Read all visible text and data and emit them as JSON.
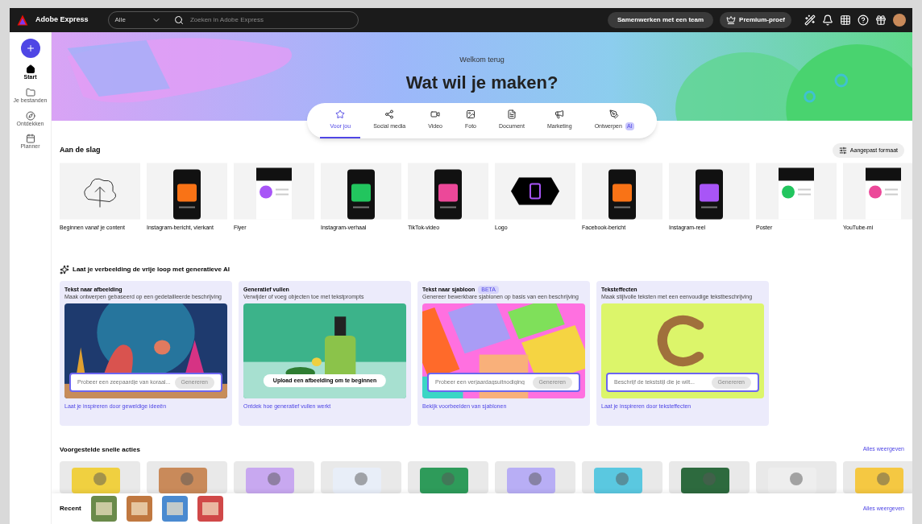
{
  "topbar": {
    "brand": "Adobe Express",
    "scope": "Alle",
    "search_placeholder": "Zoeken in Adobe Express",
    "buttons": [
      "Samenwerken met een team",
      "Premium-proef"
    ]
  },
  "sidebar": {
    "items": [
      {
        "label": "Start",
        "selected": true
      },
      {
        "label": "Je bestanden",
        "selected": false
      },
      {
        "label": "Ontdekken",
        "selected": false
      },
      {
        "label": "Planner",
        "selected": false
      }
    ]
  },
  "hero": {
    "greeting": "Welkom terug",
    "title": "Wat wil je maken?"
  },
  "tabs": [
    {
      "label": "Voor jou",
      "selected": true
    },
    {
      "label": "Social media",
      "selected": false
    },
    {
      "label": "Video",
      "selected": false
    },
    {
      "label": "Foto",
      "selected": false
    },
    {
      "label": "Document",
      "selected": false
    },
    {
      "label": "Marketing",
      "selected": false
    },
    {
      "label": "Ontwerpen",
      "selected": false,
      "badge": "AI"
    }
  ],
  "quick_start": {
    "title": "Aan de slag",
    "custom_button": "Aangepast formaat",
    "items": [
      {
        "label": "Beginnen vanaf je content",
        "kind": "upload"
      },
      {
        "label": "Instagram-bericht, vierkant",
        "kind": "phone"
      },
      {
        "label": "Flyer",
        "kind": "flyer"
      },
      {
        "label": "Instagram-verhaal",
        "kind": "phone"
      },
      {
        "label": "TikTok-video",
        "kind": "phone"
      },
      {
        "label": "Logo",
        "kind": "logo"
      },
      {
        "label": "Facebook-bericht",
        "kind": "phone"
      },
      {
        "label": "Instagram-reel",
        "kind": "phone"
      },
      {
        "label": "Poster",
        "kind": "flyer"
      },
      {
        "label": "YouTube-mi",
        "kind": "flyer"
      }
    ]
  },
  "ai": {
    "title": "Laat je verbeelding de vrije loop met generatieve AI",
    "cards": [
      {
        "title": "Tekst naar afbeelding",
        "description": "Maak ontwerpen gebaseerd op een gedetailleerde beschrijving",
        "kind": "prompt",
        "placeholder": "Probeer een zeepaardje van koraal...",
        "button": "Genereren",
        "link": "Laat je inspireren door geweldige ideeën"
      },
      {
        "title": "Generatief vullen",
        "description": "Verwijder of voeg objecten toe met tekstprompts",
        "kind": "upload",
        "button": "Upload een afbeelding om te beginnen",
        "link": "Ontdek hoe generatief vullen werkt"
      },
      {
        "title": "Tekst naar sjabloon",
        "badge": "BETA",
        "description": "Genereer bewerkbare sjablonen op basis van een beschrijving",
        "kind": "prompt",
        "placeholder": "Probeer een verjaardagsuitnodiging",
        "button": "Genereren",
        "link": "Bekijk voorbeelden van sjablonen"
      },
      {
        "title": "Teksteffecten",
        "description": "Maak stijlvolle teksten met een eenvoudige tekstbeschrijving",
        "kind": "prompt",
        "placeholder": "Beschrijf de tekststijl die je wilt...",
        "button": "Genereren",
        "link": "Laat je inspireren door teksteffecten"
      }
    ]
  },
  "quick_actions": {
    "title": "Voorgestelde snelle acties",
    "link": "Alles weergeven"
  },
  "recent": {
    "title": "Recent",
    "link": "Alles weergeven"
  }
}
